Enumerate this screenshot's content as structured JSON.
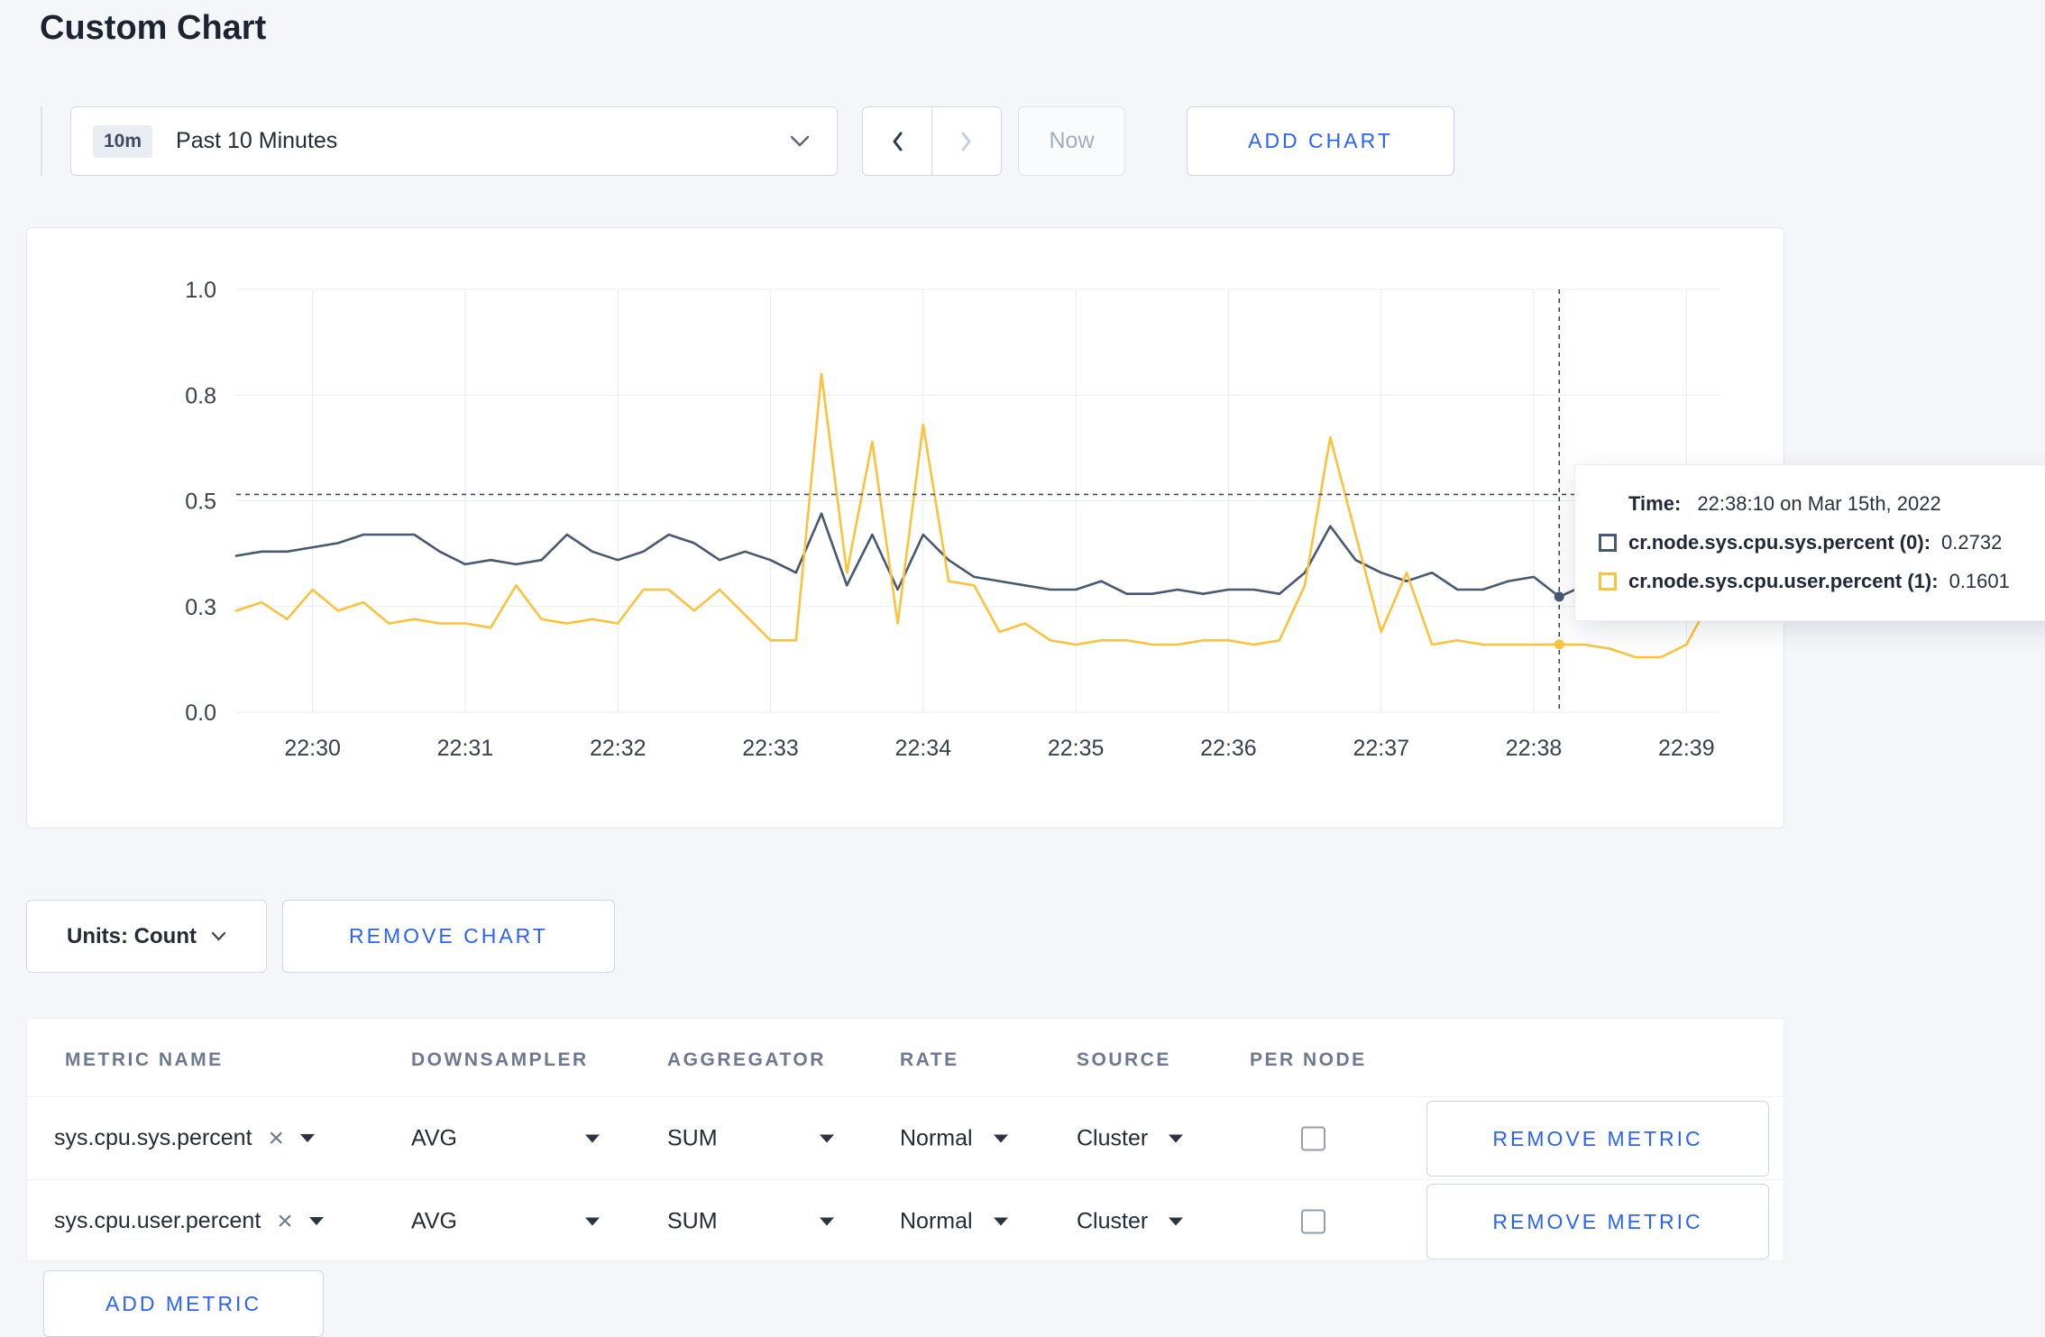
{
  "page": {
    "title": "Custom Chart"
  },
  "colors": {
    "accent": "#2962ff",
    "series_sys": "#475872",
    "series_user": "#fdc23c"
  },
  "icons": {
    "chevron_down": "chevron-down",
    "chevron_left": "chevron-left",
    "chevron_right": "chevron-right",
    "clear": "×",
    "caret_down": "caret-down"
  },
  "controls": {
    "timescale": {
      "badge": "10m",
      "label": "Past 10 Minutes"
    },
    "now_label": "Now",
    "add_chart_label": "ADD CHART"
  },
  "chart": {
    "units_label": "Units: Count",
    "remove_chart_label": "REMOVE CHART",
    "tooltip": {
      "time_label": "Time:",
      "time_value": "22:38:10 on Mar 15th, 2022",
      "rows": [
        {
          "label": "cr.node.sys.cpu.sys.percent (0):",
          "value": "0.2732"
        },
        {
          "label": "cr.node.sys.cpu.user.percent (1):",
          "value": "0.1601"
        }
      ]
    }
  },
  "chart_data": {
    "type": "line",
    "title": "",
    "ylim": [
      0,
      1
    ],
    "x_start": "22:29:30",
    "x_interval_seconds": 10,
    "x_axis_span_seconds": 583,
    "grid": true,
    "y_ticks": [
      {
        "label": "1.0",
        "value": 1.0
      },
      {
        "label": "0.8",
        "value": 0.75
      },
      {
        "label": "0.5",
        "value": 0.5
      },
      {
        "label": "0.3",
        "value": 0.25
      },
      {
        "label": "0.0",
        "value": 0.0
      }
    ],
    "x_ticks": [
      {
        "label": "22:30",
        "t": 30
      },
      {
        "label": "22:31",
        "t": 90
      },
      {
        "label": "22:32",
        "t": 150
      },
      {
        "label": "22:33",
        "t": 210
      },
      {
        "label": "22:34",
        "t": 270
      },
      {
        "label": "22:35",
        "t": 330
      },
      {
        "label": "22:36",
        "t": 390
      },
      {
        "label": "22:37",
        "t": 450
      },
      {
        "label": "22:38",
        "t": 510
      },
      {
        "label": "22:39",
        "t": 570
      }
    ],
    "crosshair": {
      "time": "22:38:10",
      "index": 52,
      "hline_value": 0.515
    },
    "series": [
      {
        "name": "cr.node.sys.cpu.sys.percent",
        "color": "#475872",
        "values": [
          0.37,
          0.38,
          0.38,
          0.39,
          0.4,
          0.42,
          0.42,
          0.42,
          0.38,
          0.35,
          0.36,
          0.35,
          0.36,
          0.42,
          0.38,
          0.36,
          0.38,
          0.42,
          0.4,
          0.36,
          0.38,
          0.36,
          0.33,
          0.47,
          0.3,
          0.42,
          0.29,
          0.42,
          0.36,
          0.32,
          0.31,
          0.3,
          0.29,
          0.29,
          0.31,
          0.28,
          0.28,
          0.29,
          0.28,
          0.29,
          0.29,
          0.28,
          0.33,
          0.44,
          0.36,
          0.33,
          0.31,
          0.33,
          0.29,
          0.29,
          0.31,
          0.32,
          0.2732,
          0.3,
          0.29,
          0.3,
          0.31,
          0.3,
          0.3
        ]
      },
      {
        "name": "cr.node.sys.cpu.user.percent",
        "color": "#fdc23c",
        "values": [
          0.24,
          0.26,
          0.22,
          0.29,
          0.24,
          0.26,
          0.21,
          0.22,
          0.21,
          0.21,
          0.2,
          0.3,
          0.22,
          0.21,
          0.22,
          0.21,
          0.29,
          0.29,
          0.24,
          0.29,
          0.23,
          0.17,
          0.17,
          0.8,
          0.33,
          0.64,
          0.21,
          0.68,
          0.31,
          0.3,
          0.19,
          0.21,
          0.17,
          0.16,
          0.17,
          0.17,
          0.16,
          0.16,
          0.17,
          0.17,
          0.16,
          0.17,
          0.3,
          0.65,
          0.42,
          0.19,
          0.33,
          0.16,
          0.17,
          0.16,
          0.16,
          0.16,
          0.1601,
          0.16,
          0.15,
          0.13,
          0.13,
          0.16,
          0.27
        ]
      }
    ]
  },
  "metrics_table": {
    "headers": [
      "METRIC NAME",
      "DOWNSAMPLER",
      "AGGREGATOR",
      "RATE",
      "SOURCE",
      "PER NODE"
    ],
    "rows": [
      {
        "name": "sys.cpu.sys.percent",
        "downsampler": "AVG",
        "aggregator": "SUM",
        "rate": "Normal",
        "source": "Cluster",
        "per_node": false,
        "remove_label": "REMOVE METRIC"
      },
      {
        "name": "sys.cpu.user.percent",
        "downsampler": "AVG",
        "aggregator": "SUM",
        "rate": "Normal",
        "source": "Cluster",
        "per_node": false,
        "remove_label": "REMOVE METRIC"
      }
    ],
    "add_metric_label": "ADD METRIC"
  }
}
